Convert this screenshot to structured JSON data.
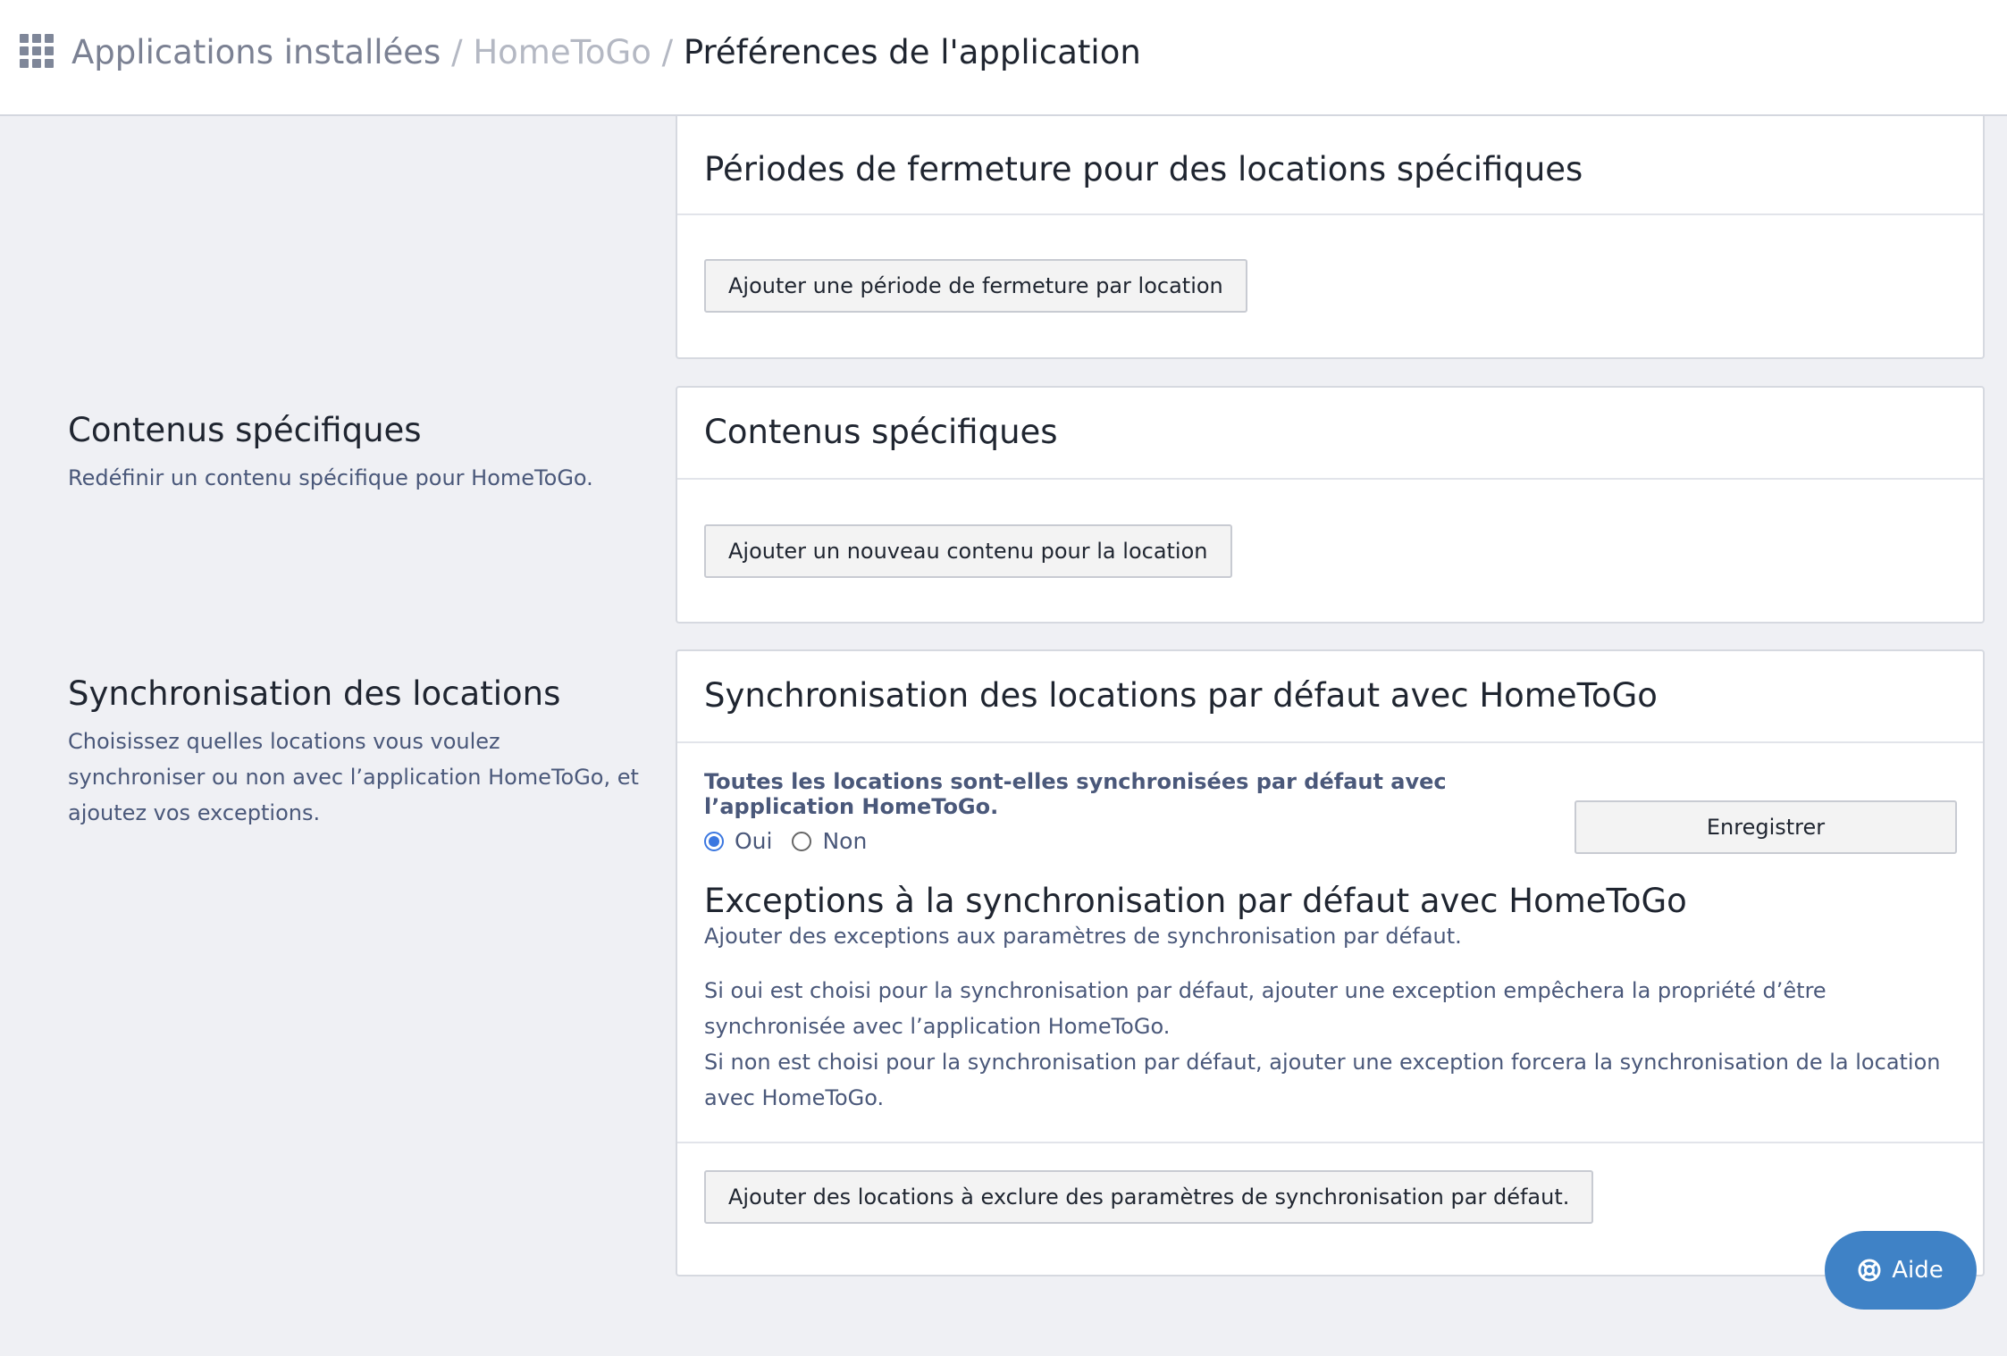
{
  "breadcrumb": {
    "part1": "Applications installées",
    "sep": "/",
    "part2": "HomeToGo",
    "part3": "Préférences de l'application"
  },
  "closure": {
    "title": "Périodes de fermeture pour des locations spécifiques",
    "button": "Ajouter une période de fermeture par location"
  },
  "content": {
    "left_title": "Contenus spécifiques",
    "left_desc": "Redéfinir un contenu spécifique pour HomeToGo.",
    "card_title": "Contenus spécifiques",
    "button": "Ajouter un nouveau contenu pour la location"
  },
  "sync": {
    "left_title": "Synchronisation des locations",
    "left_desc": "Choisissez quelles locations vous voulez synchroniser ou non avec l’application HomeToGo, et ajoutez vos exceptions.",
    "card_title": "Synchronisation des locations par défaut avec HomeToGo",
    "question": "Toutes les locations sont-elles synchronisées par défaut avec l’application HomeToGo.",
    "radio_yes": "Oui",
    "radio_no": "Non",
    "selected": "Oui",
    "save_button": "Enregistrer",
    "exceptions_title": "Exceptions à la synchronisation par défaut avec HomeToGo",
    "exceptions_subtitle": "Ajouter des exceptions aux paramètres de synchronisation par défaut.",
    "exceptions_desc_1": "Si oui est choisi pour la synchronisation par défaut, ajouter une exception empêchera la propriété d’être synchronisée avec l’application HomeToGo.",
    "exceptions_desc_2": "Si non est choisi pour la synchronisation par défaut, ajouter une exception forcera la synchronisation de la location avec HomeToGo.",
    "exclude_button": "Ajouter des locations à exclure des paramètres de synchronisation par défaut."
  },
  "help": {
    "label": "Aide",
    "icon": "lifebuoy-icon"
  },
  "colors": {
    "accent": "#3f82c6",
    "radio": "#3b77e0",
    "muted_text": "#4a587a",
    "page_bg": "#eff0f4"
  }
}
